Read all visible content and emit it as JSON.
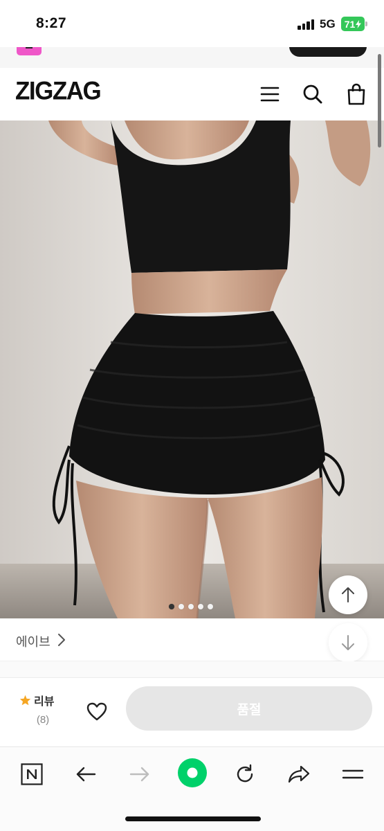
{
  "status_bar": {
    "time": "8:27",
    "network": "5G",
    "battery": "71"
  },
  "header": {
    "logo": "ZIGZAG",
    "icons": [
      "menu-icon",
      "search-icon",
      "shopping-bag-icon"
    ]
  },
  "product": {
    "image_pages": 5,
    "active_image_index": 0,
    "store_name": "에이브",
    "review_label": "리뷰",
    "review_count": "(8)",
    "soldout_label": "품절"
  },
  "colors": {
    "accent_green": "#00d16a",
    "star": "#f5a623",
    "battery": "#34c759",
    "soldout_bg": "#e6e6e6",
    "promo_icon": "#ef57c8"
  },
  "browser_toolbar": {
    "icons": [
      "naver-icon",
      "back-arrow-icon",
      "forward-arrow-icon",
      "green-dot-icon",
      "refresh-icon",
      "share-icon",
      "more-menu-icon"
    ]
  }
}
